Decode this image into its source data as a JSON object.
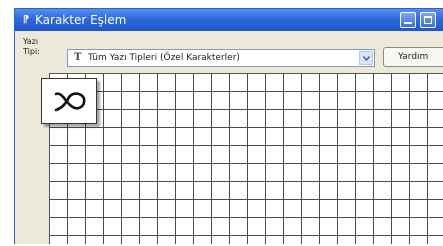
{
  "window": {
    "title": "Karakter Eşlem",
    "title_icon": "charmap-icon"
  },
  "toolbar": {
    "font_label": "Yazı Tipi:",
    "font_select_value": "Tüm Yazı Tipleri (Özel Karakterler)",
    "font_icon_glyph": "T",
    "help_button_label": "Yardım"
  },
  "preview": {
    "icon": "ribbon-loop-icon"
  },
  "colors": {
    "titlebar": "#2e68de",
    "window_bg": "#ece9d8",
    "grid_line": "#4a4a4a"
  }
}
